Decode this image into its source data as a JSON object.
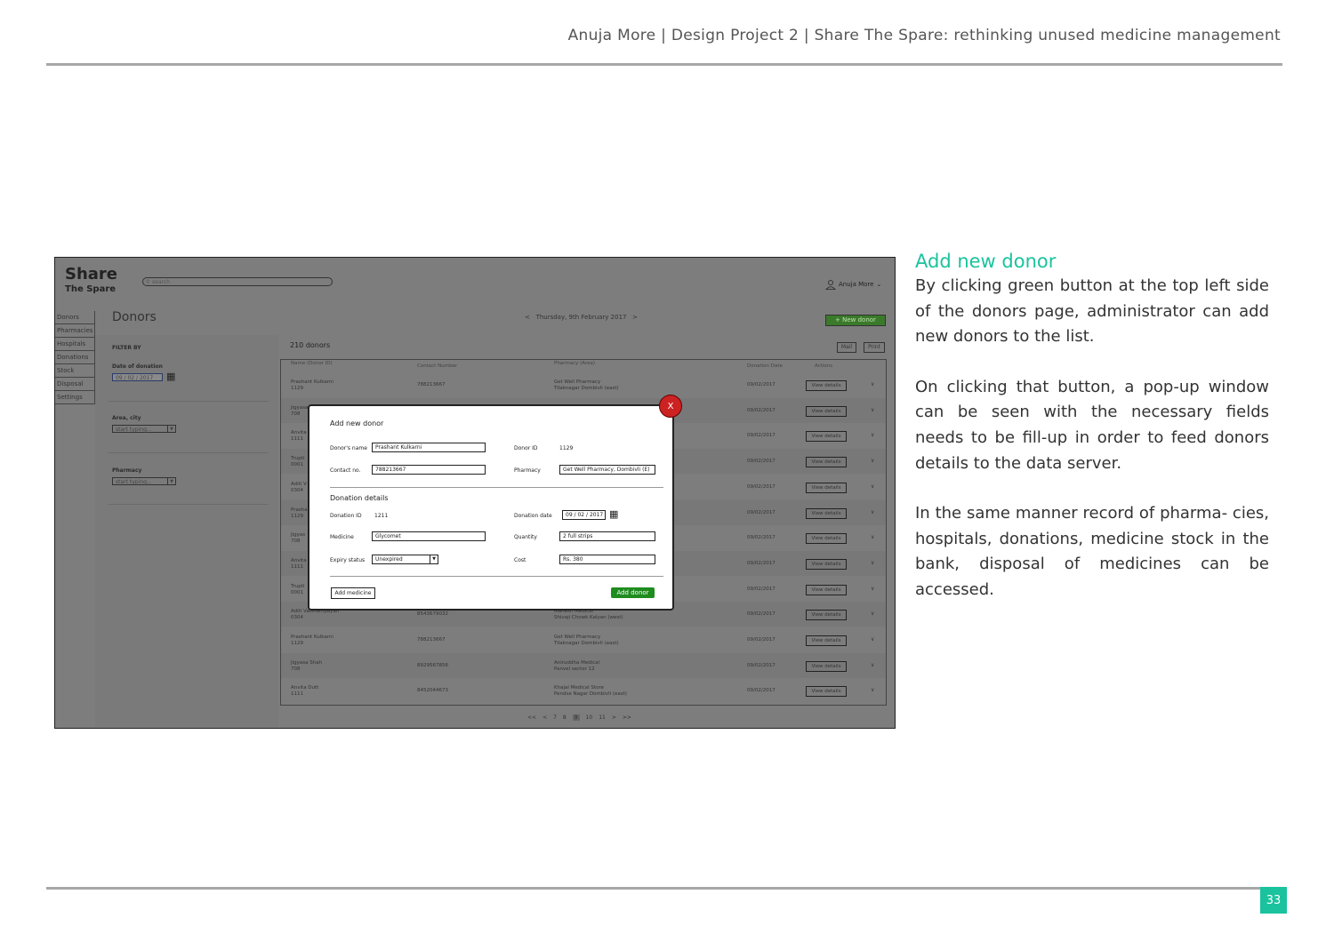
{
  "header": {
    "text": "Anuja More | Design Project 2 | Share The Spare: rethinking unused medicine management"
  },
  "page_number": "33",
  "description": {
    "title": "Add new donor",
    "paragraphs": [
      "By clicking green button at the top left side of the donors page, administrator can add new donors to the list.",
      "On clicking that button, a pop-up window can be seen with the necessary fields needs to be fill-up in order to feed donors details to the data server.",
      "In the same manner record of pharma- cies, hospitals, donations, medicine stock in the bank, disposal of medicines can be accessed."
    ]
  },
  "app": {
    "logo_line1": "Share",
    "logo_line2": "The Spare",
    "search_placeholder": "search",
    "user_name": "Anuja More",
    "sidebar": [
      "Donors",
      "Pharmacies",
      "Hospitals",
      "Donations",
      "Stock",
      "Disposal",
      "Settings"
    ],
    "page_title": "Donors",
    "date_nav": {
      "prev": "<",
      "date": "Thursday, 9th February 2017",
      "next": ">"
    },
    "new_donor_button": "+ New donor",
    "filter": {
      "heading": "FILTER BY",
      "date_label": "Date of donation",
      "date_value": "09 / 02 / 2017",
      "area_label": "Area, city",
      "area_placeholder": "start typing...",
      "pharmacy_label": "Pharmacy",
      "pharmacy_placeholder": "start typing..."
    },
    "donor_count": "210 donors",
    "mail_button": "Mail",
    "print_button": "Print",
    "table": {
      "headers": [
        "Name (Donor ID)",
        "Contact Number",
        "Pharmacy (Area)",
        "Donation Date",
        "Actions"
      ],
      "action_label": "View details",
      "rows": [
        {
          "name": "Prashant Kulkarni",
          "id": "1129",
          "contact": "788213667",
          "pharmacy": "Get Well Pharmacy",
          "area": "Tilaknagar Dombivli (east)",
          "date": "09/02/2017"
        },
        {
          "name": "Jigyasa",
          "id": "708",
          "contact": "",
          "pharmacy": "",
          "area": "",
          "date": "09/02/2017"
        },
        {
          "name": "Anvita",
          "id": "1111",
          "contact": "",
          "pharmacy": "",
          "area": "",
          "date": "09/02/2017"
        },
        {
          "name": "Trupti",
          "id": "0001",
          "contact": "",
          "pharmacy": "",
          "area": "",
          "date": "09/02/2017"
        },
        {
          "name": "Aditi V",
          "id": "0304",
          "contact": "",
          "pharmacy": "",
          "area": "",
          "date": "09/02/2017"
        },
        {
          "name": "Prasha",
          "id": "1129",
          "contact": "",
          "pharmacy": "",
          "area": "",
          "date": "09/02/2017"
        },
        {
          "name": "Jigyas",
          "id": "708",
          "contact": "",
          "pharmacy": "",
          "area": "",
          "date": "09/02/2017"
        },
        {
          "name": "Anvita",
          "id": "1111",
          "contact": "",
          "pharmacy": "",
          "area": "",
          "date": "09/02/2017"
        },
        {
          "name": "Trupti",
          "id": "0001",
          "contact": "",
          "pharmacy": "",
          "area": "",
          "date": "09/02/2017"
        },
        {
          "name": "Aditi Vaishampayan",
          "id": "0304",
          "contact": "8543679032",
          "pharmacy": "Mahesh Medical",
          "area": "Shivaji Chowk Kalyan (west)",
          "date": "09/02/2017"
        },
        {
          "name": "Prashant Kulkarni",
          "id": "1129",
          "contact": "788213667",
          "pharmacy": "Get Well Pharmacy",
          "area": "Tilaknagar Dombivli (east)",
          "date": "09/02/2017"
        },
        {
          "name": "Jigyasa Shah",
          "id": "708",
          "contact": "8929567856",
          "pharmacy": "Aniruddha Medical",
          "area": "Panvel sector 12",
          "date": "09/02/2017"
        },
        {
          "name": "Anvita Dutt",
          "id": "1111",
          "contact": "8452044673",
          "pharmacy": "Khajal Medical Store",
          "area": "Pendse Nagar Dombivli (east)",
          "date": "09/02/2017"
        }
      ]
    },
    "pagination": [
      "<<",
      "<",
      "7",
      "8",
      "9",
      "10",
      "11",
      ">",
      ">>"
    ],
    "pagination_current": "9"
  },
  "modal": {
    "close_label": "X",
    "title": "Add new donor",
    "donor_name_label": "Donor's name",
    "donor_name_value": "Prashant Kulkarni",
    "donor_id_label": "Donor ID",
    "donor_id_value": "1129",
    "contact_label": "Contact no.",
    "contact_value": "788213667",
    "pharmacy_label": "Pharmacy",
    "pharmacy_value": "Get Well Pharmacy, Dombivli (E)",
    "section_title": "Donation details",
    "donation_id_label": "Donation ID",
    "donation_id_value": "1211",
    "donation_date_label": "Donation date",
    "donation_date_value": "09 / 02 / 2017",
    "medicine_label": "Medicine",
    "medicine_value": "Glycomet",
    "quantity_label": "Quantity",
    "quantity_value": "2 full strips",
    "expiry_label": "Expiry status",
    "expiry_value": "Unexpired",
    "cost_label": "Cost",
    "cost_value": "Rs. 380",
    "add_medicine_button": "Add medicine",
    "add_donor_button": "Add donor"
  },
  "colors": {
    "accent": "#1ac39e",
    "add_donor": "#1e8c1e",
    "close": "#cc2222",
    "overlay": "#7d7d7d"
  }
}
